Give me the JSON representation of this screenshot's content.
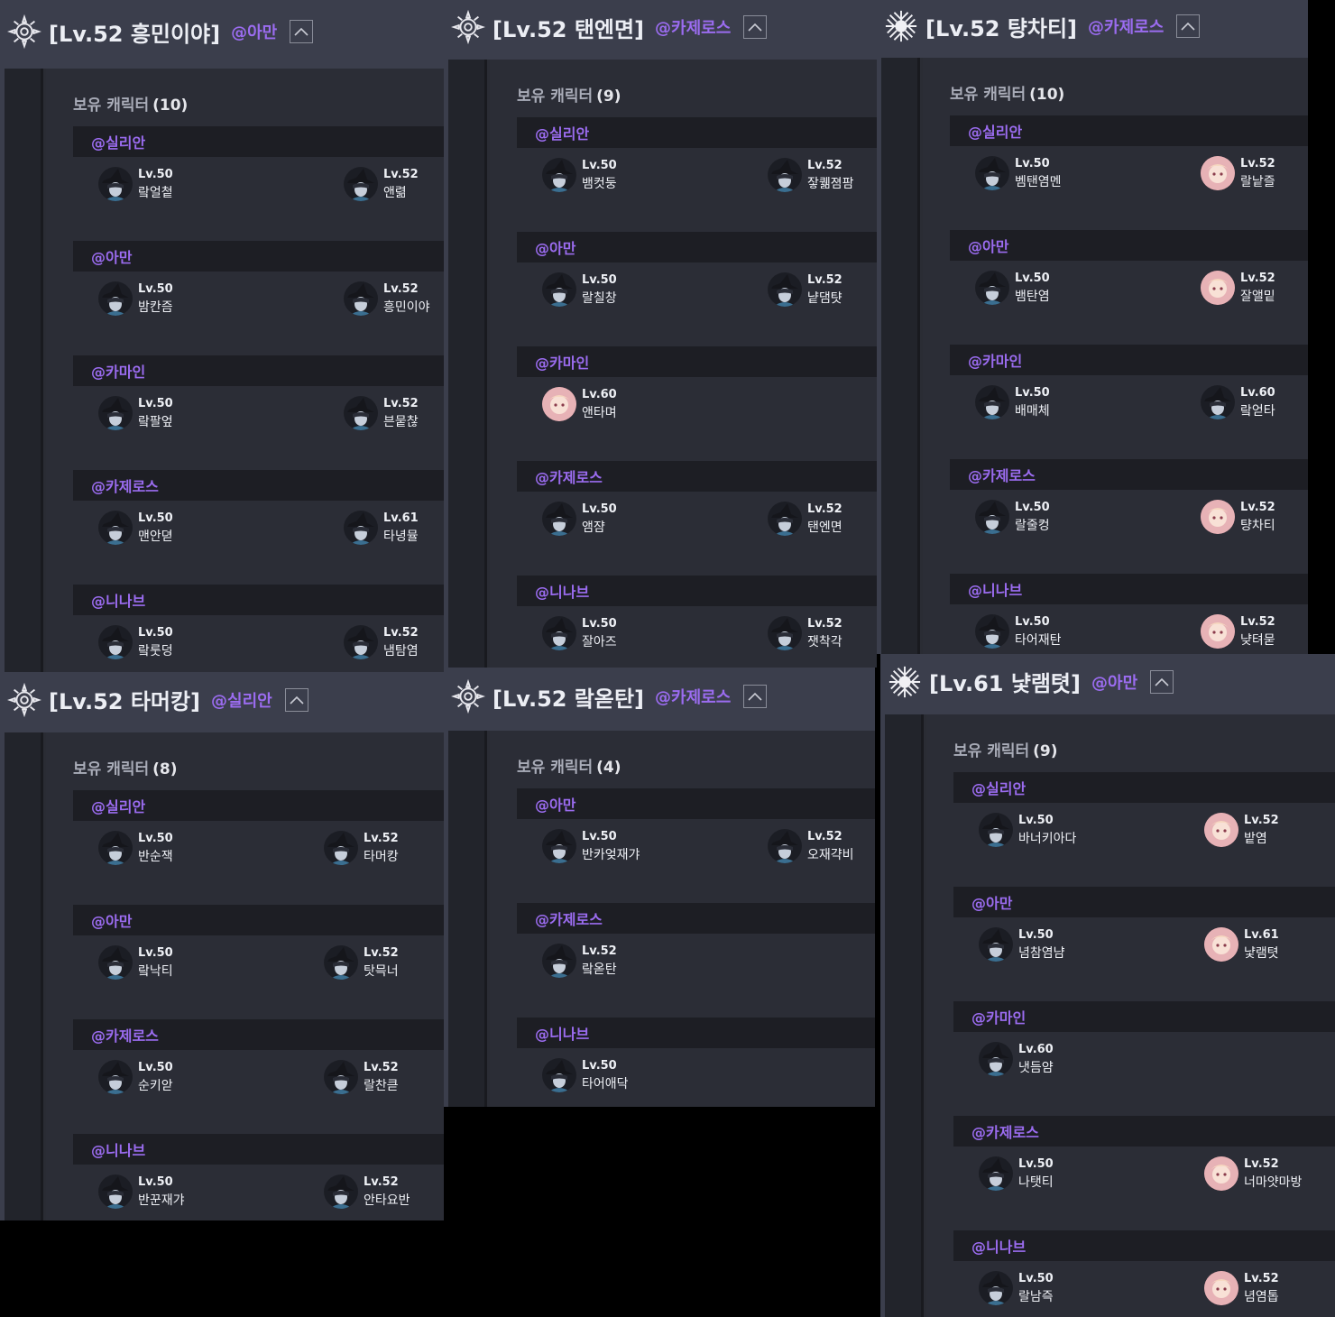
{
  "panels": [
    {
      "title": "[Lv.52 흥민이야]",
      "server": "@아만",
      "own_label": "보유 캐릭터",
      "own_count": "(10)",
      "groups": [
        {
          "server": "@실리안",
          "chars": [
            {
              "lv": "Lv.50",
              "name": "랔얼첱",
              "avatar": "witch"
            },
            {
              "lv": "Lv.52",
              "name": "앤렮",
              "avatar": "witch"
            }
          ]
        },
        {
          "server": "@아만",
          "chars": [
            {
              "lv": "Lv.50",
              "name": "밤칸즘",
              "avatar": "witch"
            },
            {
              "lv": "Lv.52",
              "name": "흥민이야",
              "avatar": "witch"
            }
          ]
        },
        {
          "server": "@카마인",
          "chars": [
            {
              "lv": "Lv.50",
              "name": "랔팔엎",
              "avatar": "witch"
            },
            {
              "lv": "Lv.52",
              "name": "븐뭍찮",
              "avatar": "witch"
            }
          ]
        },
        {
          "server": "@카제로스",
          "chars": [
            {
              "lv": "Lv.50",
              "name": "맨안뎓",
              "avatar": "witch"
            },
            {
              "lv": "Lv.61",
              "name": "타녕뮬",
              "avatar": "witch"
            }
          ]
        },
        {
          "server": "@니나브",
          "chars": [
            {
              "lv": "Lv.50",
              "name": "랔룻덩",
              "avatar": "witch"
            },
            {
              "lv": "Lv.52",
              "name": "냄탐염",
              "avatar": "witch"
            }
          ]
        }
      ]
    },
    {
      "title": "[Lv.52 탠엔면]",
      "server": "@카제로스",
      "own_label": "보유 캐릭터",
      "own_count": "(9)",
      "groups": [
        {
          "server": "@실리안",
          "chars": [
            {
              "lv": "Lv.50",
              "name": "뱀컷둥",
              "avatar": "witch"
            },
            {
              "lv": "Lv.52",
              "name": "잫퀢졈팜",
              "avatar": "witch"
            }
          ]
        },
        {
          "server": "@아만",
          "chars": [
            {
              "lv": "Lv.50",
              "name": "랄칠창",
              "avatar": "witch"
            },
            {
              "lv": "Lv.52",
              "name": "냩댐턋",
              "avatar": "witch"
            }
          ]
        },
        {
          "server": "@카마인",
          "chars": [
            {
              "lv": "Lv.60",
              "name": "앤타며",
              "avatar": "fairy"
            }
          ]
        },
        {
          "server": "@카제로스",
          "chars": [
            {
              "lv": "Lv.50",
              "name": "앰쟘",
              "avatar": "witch"
            },
            {
              "lv": "Lv.52",
              "name": "탠엔면",
              "avatar": "witch"
            }
          ]
        },
        {
          "server": "@니나브",
          "chars": [
            {
              "lv": "Lv.50",
              "name": "잘아즈",
              "avatar": "witch"
            },
            {
              "lv": "Lv.52",
              "name": "잿착각",
              "avatar": "witch"
            }
          ]
        }
      ]
    },
    {
      "title": "[Lv.52 턍차티]",
      "server": "@카제로스",
      "own_label": "보유 캐릭터",
      "own_count": "(10)",
      "groups": [
        {
          "server": "@실리안",
          "chars": [
            {
              "lv": "Lv.50",
              "name": "벰탠염멘",
              "avatar": "witch"
            },
            {
              "lv": "Lv.52",
              "name": "랄낱즐",
              "avatar": "fairy"
            }
          ]
        },
        {
          "server": "@아만",
          "chars": [
            {
              "lv": "Lv.50",
              "name": "뱀탄염",
              "avatar": "witch"
            },
            {
              "lv": "Lv.52",
              "name": "잘앨밑",
              "avatar": "fairy"
            }
          ]
        },
        {
          "server": "@카마인",
          "chars": [
            {
              "lv": "Lv.50",
              "name": "배매체",
              "avatar": "witch"
            },
            {
              "lv": "Lv.60",
              "name": "랔얻타",
              "avatar": "witch"
            }
          ]
        },
        {
          "server": "@카제로스",
          "chars": [
            {
              "lv": "Lv.50",
              "name": "랄줄컹",
              "avatar": "witch"
            },
            {
              "lv": "Lv.52",
              "name": "턍차티",
              "avatar": "fairy"
            }
          ]
        },
        {
          "server": "@니나브",
          "chars": [
            {
              "lv": "Lv.50",
              "name": "타어재탄",
              "avatar": "witch"
            },
            {
              "lv": "Lv.52",
              "name": "냦텨묻",
              "avatar": "fairy"
            }
          ]
        }
      ]
    },
    {
      "title": "[Lv.52 타머캉]",
      "server": "@실리안",
      "own_label": "보유 캐릭터",
      "own_count": "(8)",
      "groups": [
        {
          "server": "@실리안",
          "chars": [
            {
              "lv": "Lv.50",
              "name": "반순잭",
              "avatar": "witch"
            },
            {
              "lv": "Lv.52",
              "name": "타머캉",
              "avatar": "witch"
            }
          ]
        },
        {
          "server": "@아만",
          "chars": [
            {
              "lv": "Lv.50",
              "name": "랔낙티",
              "avatar": "witch"
            },
            {
              "lv": "Lv.52",
              "name": "탓믁너",
              "avatar": "witch"
            }
          ]
        },
        {
          "server": "@카제로스",
          "chars": [
            {
              "lv": "Lv.50",
              "name": "순키앋",
              "avatar": "witch"
            },
            {
              "lv": "Lv.52",
              "name": "랄찬큳",
              "avatar": "witch"
            }
          ]
        },
        {
          "server": "@니나브",
          "chars": [
            {
              "lv": "Lv.50",
              "name": "반꾼재갸",
              "avatar": "witch"
            },
            {
              "lv": "Lv.52",
              "name": "안타요반",
              "avatar": "witch"
            }
          ]
        }
      ]
    },
    {
      "title": "[Lv.52 랔옫탄]",
      "server": "@카제로스",
      "own_label": "보유 캐릭터",
      "own_count": "(4)",
      "groups": [
        {
          "server": "@아만",
          "chars": [
            {
              "lv": "Lv.50",
              "name": "반카엊재갸",
              "avatar": "witch"
            },
            {
              "lv": "Lv.52",
              "name": "오재갹비",
              "avatar": "witch"
            }
          ]
        },
        {
          "server": "@카제로스",
          "chars": [
            {
              "lv": "Lv.52",
              "name": "랔옫탄",
              "avatar": "witch"
            }
          ]
        },
        {
          "server": "@니나브",
          "chars": [
            {
              "lv": "Lv.50",
              "name": "타어애닥",
              "avatar": "witch"
            }
          ]
        }
      ]
    },
    {
      "title": "[Lv.61 냧램텻]",
      "server": "@아만",
      "own_label": "보유 캐릭터",
      "own_count": "(9)",
      "groups": [
        {
          "server": "@실리안",
          "chars": [
            {
              "lv": "Lv.50",
              "name": "바너키아다",
              "avatar": "witch"
            },
            {
              "lv": "Lv.52",
              "name": "밭염",
              "avatar": "fairy"
            }
          ]
        },
        {
          "server": "@아만",
          "chars": [
            {
              "lv": "Lv.50",
              "name": "념참염냠",
              "avatar": "witch"
            },
            {
              "lv": "Lv.61",
              "name": "냧램텻",
              "avatar": "fairy"
            }
          ]
        },
        {
          "server": "@카마인",
          "chars": [
            {
              "lv": "Lv.60",
              "name": "냇듬얌",
              "avatar": "witch"
            }
          ]
        },
        {
          "server": "@카제로스",
          "chars": [
            {
              "lv": "Lv.50",
              "name": "나탯티",
              "avatar": "witch"
            },
            {
              "lv": "Lv.52",
              "name": "너마얏마방",
              "avatar": "fairy"
            }
          ]
        },
        {
          "server": "@니나브",
          "chars": [
            {
              "lv": "Lv.50",
              "name": "랄남즉",
              "avatar": "witch"
            },
            {
              "lv": "Lv.52",
              "name": "념염톱",
              "avatar": "fairy"
            }
          ]
        }
      ]
    }
  ]
}
